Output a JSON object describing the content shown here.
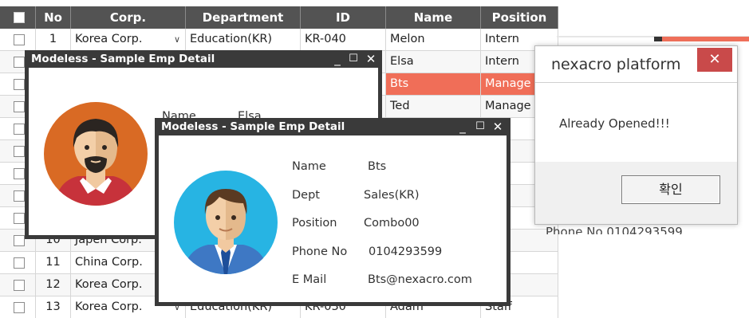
{
  "grid": {
    "headers": [
      "No",
      "Corp.",
      "Department",
      "ID",
      "Name",
      "Position"
    ],
    "rows": [
      {
        "no": "1",
        "corp": "Korea Corp.",
        "dept": "Education(KR)",
        "id": "KR-040",
        "name": "Melon",
        "position": "Intern"
      },
      {
        "no": "",
        "corp": "",
        "dept": "",
        "id": "",
        "name": "Elsa",
        "position": "Intern"
      },
      {
        "no": "",
        "corp": "",
        "dept": "",
        "id": "",
        "name": "Bts",
        "position": "Manage"
      },
      {
        "no": "",
        "corp": "",
        "dept": "",
        "id": "",
        "name": "Ted",
        "position": "Manage"
      },
      {
        "no": "",
        "corp": "",
        "dept": "",
        "id": "",
        "name": "",
        "position": "ger"
      },
      {
        "no": "",
        "corp": "",
        "dept": "",
        "id": "",
        "name": "",
        "position": "ge"
      },
      {
        "no": "",
        "corp": "",
        "dept": "",
        "id": "",
        "name": "",
        "position": ""
      },
      {
        "no": "",
        "corp": "",
        "dept": "",
        "id": "",
        "name": "",
        "position": "ge"
      },
      {
        "no": "",
        "corp": "",
        "dept": "",
        "id": "",
        "name": "",
        "position": ""
      },
      {
        "no": "10",
        "corp": "Japen Corp.",
        "dept": "",
        "id": "",
        "name": "",
        "position": "n"
      },
      {
        "no": "11",
        "corp": "China Corp.",
        "dept": "",
        "id": "",
        "name": "",
        "position": "ger"
      },
      {
        "no": "12",
        "corp": "Korea Corp.",
        "dept": "",
        "id": "",
        "name": "",
        "position": "ger"
      },
      {
        "no": "13",
        "corp": "Korea Corp.",
        "dept": "Education(KR)",
        "id": "KR-030",
        "name": "Adam",
        "position": "Staff"
      }
    ]
  },
  "window1": {
    "title": "Modeless - Sample Emp Detail",
    "name_label": "Name",
    "name_value": "Elsa"
  },
  "window2": {
    "title": "Modeless - Sample Emp Detail",
    "fields": [
      {
        "label": "Name",
        "value": "Bts"
      },
      {
        "label": "Dept",
        "value": "Sales(KR)"
      },
      {
        "label": "Position",
        "value": "Combo00"
      },
      {
        "label": "Phone No",
        "value": "0104293599"
      },
      {
        "label": "E Mail",
        "value": "Bts@nexacro.com"
      }
    ]
  },
  "window_buttons": {
    "minimize": "_",
    "maximize": "☐",
    "close": "✕"
  },
  "alert": {
    "title": "nexacro platform",
    "close": "✕",
    "message": "Already Opened!!!",
    "ok_label": "확인"
  },
  "behind_text": "Phone No   0104293599",
  "colors": {
    "header": "#535353",
    "highlight": "#f06e58",
    "window_frame": "#3a3a3a",
    "alert_close": "#c94a4a"
  }
}
